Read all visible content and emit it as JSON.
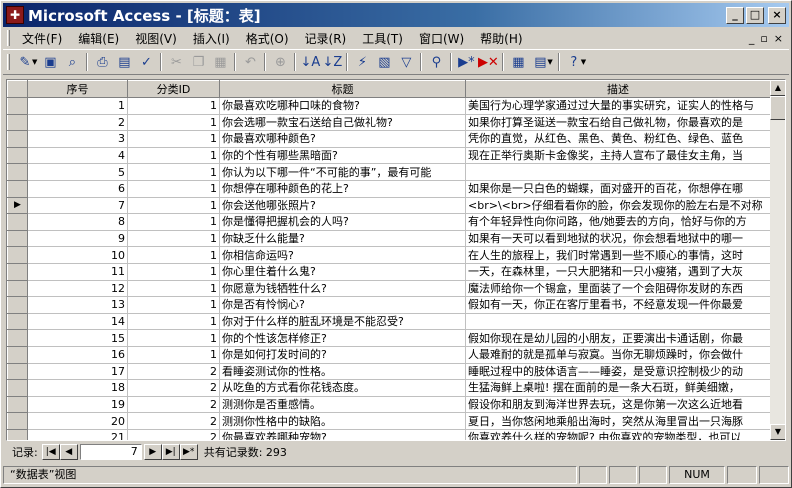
{
  "window": {
    "title": "Microsoft Access - [标题：表]",
    "minimize": "_",
    "maximize": "□",
    "close": "×"
  },
  "menu": {
    "items": [
      "文件(F)",
      "编辑(E)",
      "视图(V)",
      "插入(I)",
      "格式(O)",
      "记录(R)",
      "工具(T)",
      "窗口(W)",
      "帮助(H)"
    ],
    "doc_controls": [
      "_",
      "▫",
      "×"
    ]
  },
  "toolbar": {
    "icons": [
      "design-view-icon",
      "save-icon",
      "search-icon",
      "print-icon",
      "print-preview-icon",
      "spelling-icon",
      "cut-icon",
      "copy-icon",
      "paste-icon",
      "undo-icon",
      "hyperlink-icon",
      "sort-ascending-icon",
      "sort-descending-icon",
      "filter-by-selection-icon",
      "filter-by-form-icon",
      "apply-filter-icon",
      "find-icon",
      "new-record-icon",
      "delete-record-icon",
      "database-window-icon",
      "new-object-icon",
      "help-icon"
    ]
  },
  "grid": {
    "columns": [
      "序号",
      "分类ID",
      "标题",
      "描述"
    ],
    "current_row_index": 6,
    "rows": [
      {
        "id": "1",
        "cat": "1",
        "title": "你最喜欢吃哪种口味的食物?",
        "desc": "美国行为心理学家通过过大量的事实研究，证实人的性格与"
      },
      {
        "id": "2",
        "cat": "1",
        "title": "你会选哪一款宝石送给自己做礼物?",
        "desc": "如果你打算圣诞送一款宝石给自己做礼物，你最喜欢的是"
      },
      {
        "id": "3",
        "cat": "1",
        "title": "你最喜欢哪种颜色?",
        "desc": "凭你的直觉，从红色、黑色、黄色、粉红色、绿色、蓝色"
      },
      {
        "id": "4",
        "cat": "1",
        "title": "你的个性有哪些黑暗面?",
        "desc": "现在正举行奥斯卡金像奖，主持人宣布了最佳女主角，当"
      },
      {
        "id": "5",
        "cat": "1",
        "title": "你认为以下哪一件“不可能的事”，最有可能",
        "desc": ""
      },
      {
        "id": "6",
        "cat": "1",
        "title": "你想停在哪种颜色的花上?",
        "desc": "如果你是一只白色的蝴蝶，面对盛开的百花，你想停在哪"
      },
      {
        "id": "7",
        "cat": "1",
        "title": "你会送他哪张照片?",
        "desc": "<br>\\<br>仔细看看你的脸，你会发现你的脸左右是不对称"
      },
      {
        "id": "8",
        "cat": "1",
        "title": "你是懂得把握机会的人吗?",
        "desc": "有个年轻异性向你问路，他/她要去的方向，恰好与你的方"
      },
      {
        "id": "9",
        "cat": "1",
        "title": "你缺乏什么能量?",
        "desc": "如果有一天可以看到地狱的状况，你会想看地狱中的哪一"
      },
      {
        "id": "10",
        "cat": "1",
        "title": "你相信命运吗?",
        "desc": "在人生的旅程上，我们时常遇到一些不顺心的事情，这时"
      },
      {
        "id": "11",
        "cat": "1",
        "title": "你心里住着什么鬼?",
        "desc": "一天，在森林里，一只大肥猪和一只小瘦猪，遇到了大灰"
      },
      {
        "id": "12",
        "cat": "1",
        "title": "你愿意为钱牺牲什么?",
        "desc": "魔法师给你一个锡盒，里面装了一个会阻碍你发财的东西"
      },
      {
        "id": "13",
        "cat": "1",
        "title": "你是否有怜悯心?",
        "desc": "假如有一天，你正在客厅里看书，不经意发现一件你最爱"
      },
      {
        "id": "14",
        "cat": "1",
        "title": "你对于什么样的脏乱环境是不能忍受?",
        "desc": ""
      },
      {
        "id": "15",
        "cat": "1",
        "title": "你的个性该怎样修正?",
        "desc": "假如你现在是幼儿园的小朋友，正要演出卡通话剧，你最"
      },
      {
        "id": "16",
        "cat": "1",
        "title": "你是如何打发时间的?",
        "desc": "人最难耐的就是孤单与寂寞。当你无聊烦躁时，你会做什"
      },
      {
        "id": "17",
        "cat": "2",
        "title": "看睡姿测试你的性格。",
        "desc": "睡眠过程中的肢体语言——睡姿，是受意识控制极少的动"
      },
      {
        "id": "18",
        "cat": "2",
        "title": "从吃鱼的方式看你花钱态度。",
        "desc": "生猛海鲜上桌啦! 摆在面前的是一条大石斑，鲜美细嫩，"
      },
      {
        "id": "19",
        "cat": "2",
        "title": "测测你是否重感情。",
        "desc": "假设你和朋友到海洋世界去玩，这是你第一次这么近地看"
      },
      {
        "id": "20",
        "cat": "2",
        "title": "测测你性格中的缺陷。",
        "desc": "夏日，当你悠闲地乘船出海时，突然从海里冒出一只海豚"
      },
      {
        "id": "21",
        "cat": "2",
        "title": "你最喜欢养哪种宠物?",
        "desc": "你喜欢养什么样的宠物呢? 由你喜欢的宠物类型，也可以"
      },
      {
        "id": "22",
        "cat": "2",
        "title": "你有多爱占人家的便宜?",
        "desc": "生活中我们常常遇到很多爱占人家小便宜的人! 今天讲入"
      }
    ]
  },
  "navigation": {
    "label": "记录:",
    "current_record": "7",
    "total_text": "共有记录数: 293",
    "first": "|◀",
    "prev": "◀",
    "next": "▶",
    "last": "▶|",
    "new": "▶*"
  },
  "status": {
    "view": "“数据表”视图",
    "num": "NUM"
  }
}
